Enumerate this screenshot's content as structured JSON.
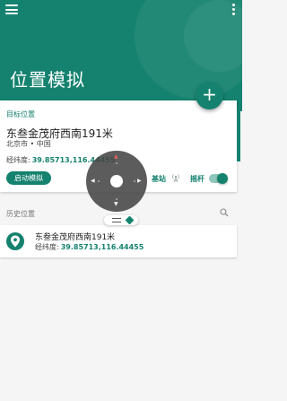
{
  "header": {
    "title": "位置模拟"
  },
  "target": {
    "label": "目标位置",
    "name": "东叁金茂府西南191米",
    "region": "北京市 • 中国",
    "coord_label": "经纬度:",
    "coord_value": "39.85713,116.44455",
    "start_button": "启动模拟",
    "base_station_label": "基站",
    "joystick_label": "摇杆",
    "joystick_enabled": true
  },
  "history": {
    "section_label": "历史位置",
    "items": [
      {
        "name": "东叁金茂府西南191米",
        "coord_label": "经纬度:",
        "coord_value": "39.85713,116.44455"
      }
    ]
  },
  "icons": {
    "menu": "menu-icon",
    "more": "more-vert-icon",
    "add": "plus-icon",
    "tower": "cell-tower-icon",
    "search": "search-icon",
    "pin": "location-pin-icon"
  },
  "colors": {
    "primary": "#15826f",
    "joystick": "#464646"
  }
}
